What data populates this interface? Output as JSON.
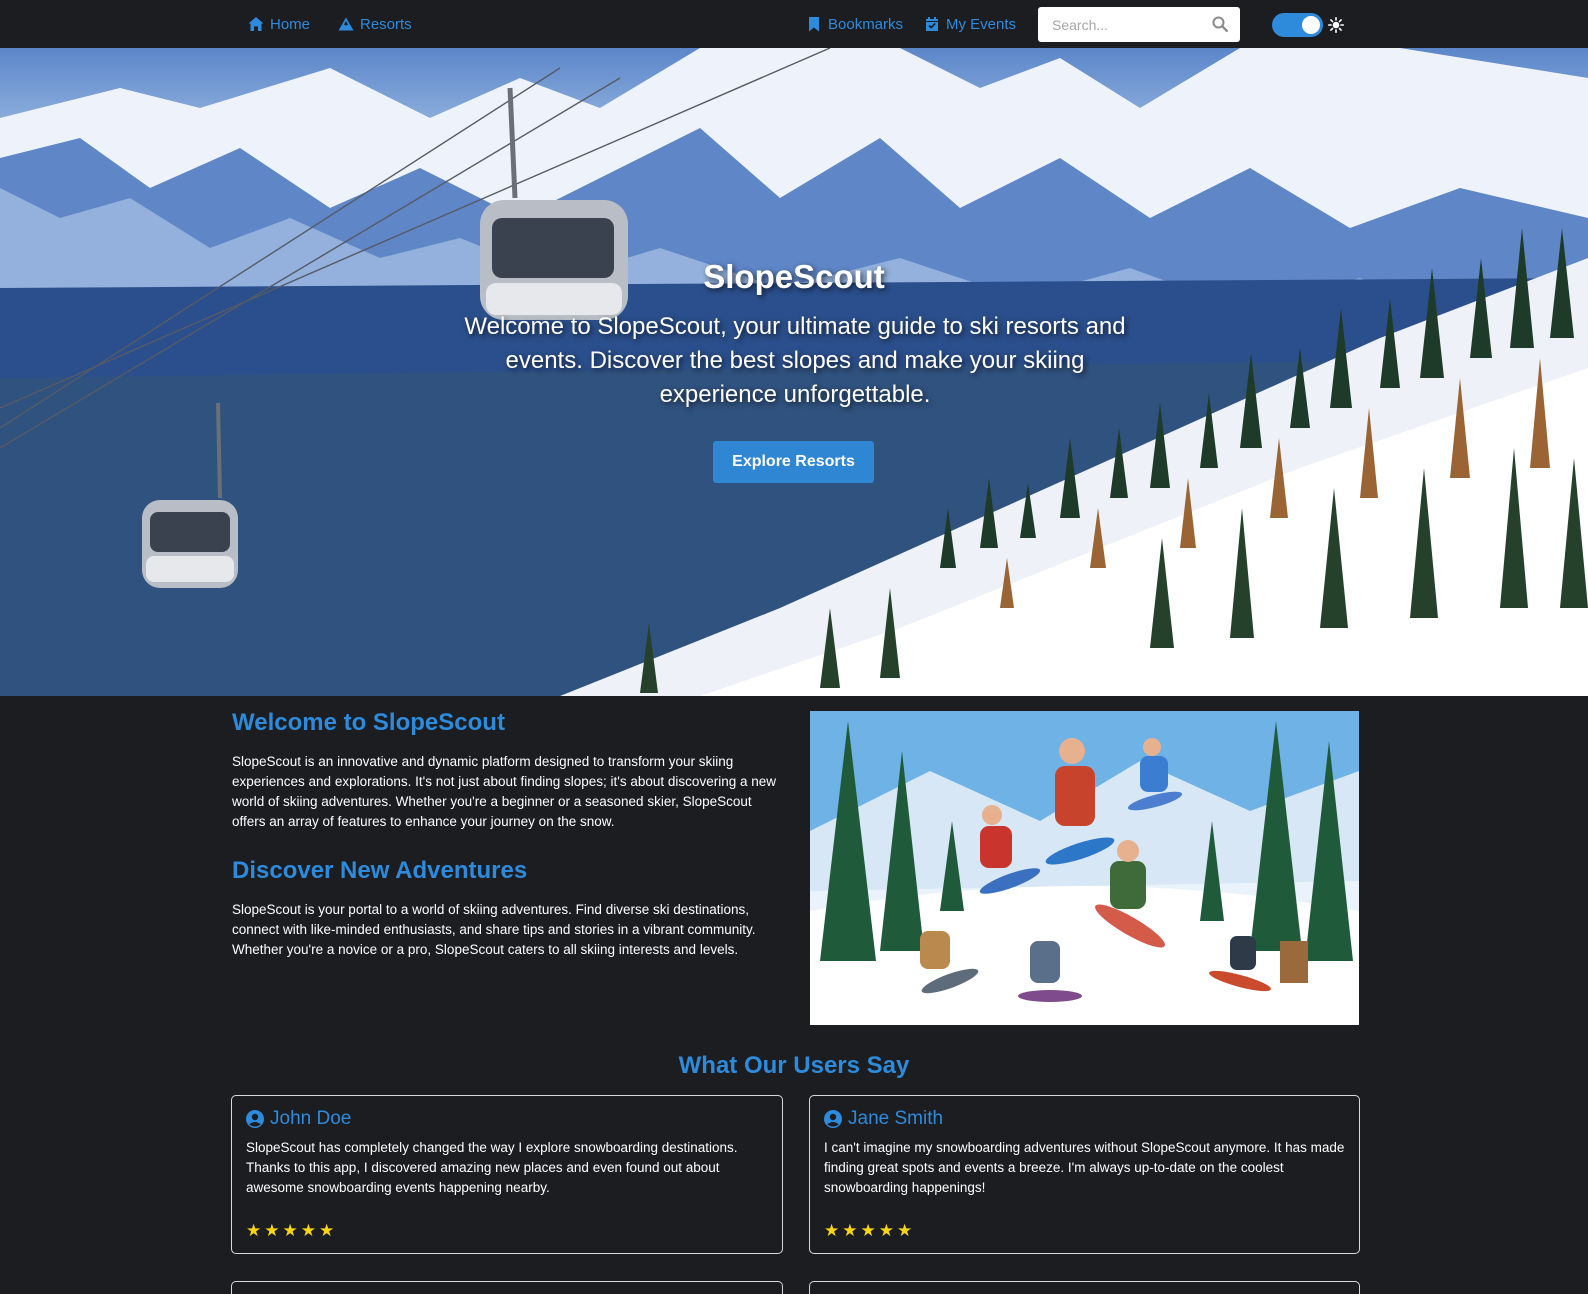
{
  "nav": {
    "home": "Home",
    "resorts": "Resorts",
    "bookmarks": "Bookmarks",
    "my_events": "My Events",
    "search_placeholder": "Search...",
    "theme_toggle": "on"
  },
  "hero": {
    "title": "SlopeScout",
    "text": "Welcome to SlopeScout, your ultimate guide to ski resorts and events. Discover the best slopes and make your skiing experience unforgettable.",
    "button": "Explore Resorts"
  },
  "about": {
    "heading1": "Welcome to SlopeScout",
    "paragraph1": "SlopeScout is an innovative and dynamic platform designed to transform your skiing experiences and explorations. It's not just about finding slopes; it's about discovering a new world of skiing adventures. Whether you're a beginner or a seasoned skier, SlopeScout offers an array of features to enhance your journey on the snow.",
    "heading2": "Discover New Adventures",
    "paragraph2": "SlopeScout is your portal to a world of skiing adventures. Find diverse ski destinations, connect with like-minded enthusiasts, and share tips and stories in a vibrant community. Whether you're a novice or a pro, SlopeScout caters to all skiing interests and levels."
  },
  "testimonials": {
    "title": "What Our Users Say",
    "items": [
      {
        "name": "John Doe",
        "text": "SlopeScout has completely changed the way I explore snowboarding destinations. Thanks to this app, I discovered amazing new places and even found out about awesome snowboarding events happening nearby.",
        "rating": 5
      },
      {
        "name": "Jane Smith",
        "text": "I can't imagine my snowboarding adventures without SlopeScout anymore. It has made finding great spots and events a breeze. I'm always up-to-date on the coolest snowboarding happenings!",
        "rating": 5
      }
    ]
  },
  "colors": {
    "accent": "#2e8bdc",
    "background": "#1b1d21",
    "star": "#f7d514"
  },
  "icons": {
    "home": "home-icon",
    "resorts": "mountain-icon",
    "bookmarks": "bookmark-icon",
    "events": "calendar-check-icon",
    "search": "search-icon",
    "theme": "sun-icon",
    "user": "user-circle-icon",
    "star": "star-icon"
  }
}
